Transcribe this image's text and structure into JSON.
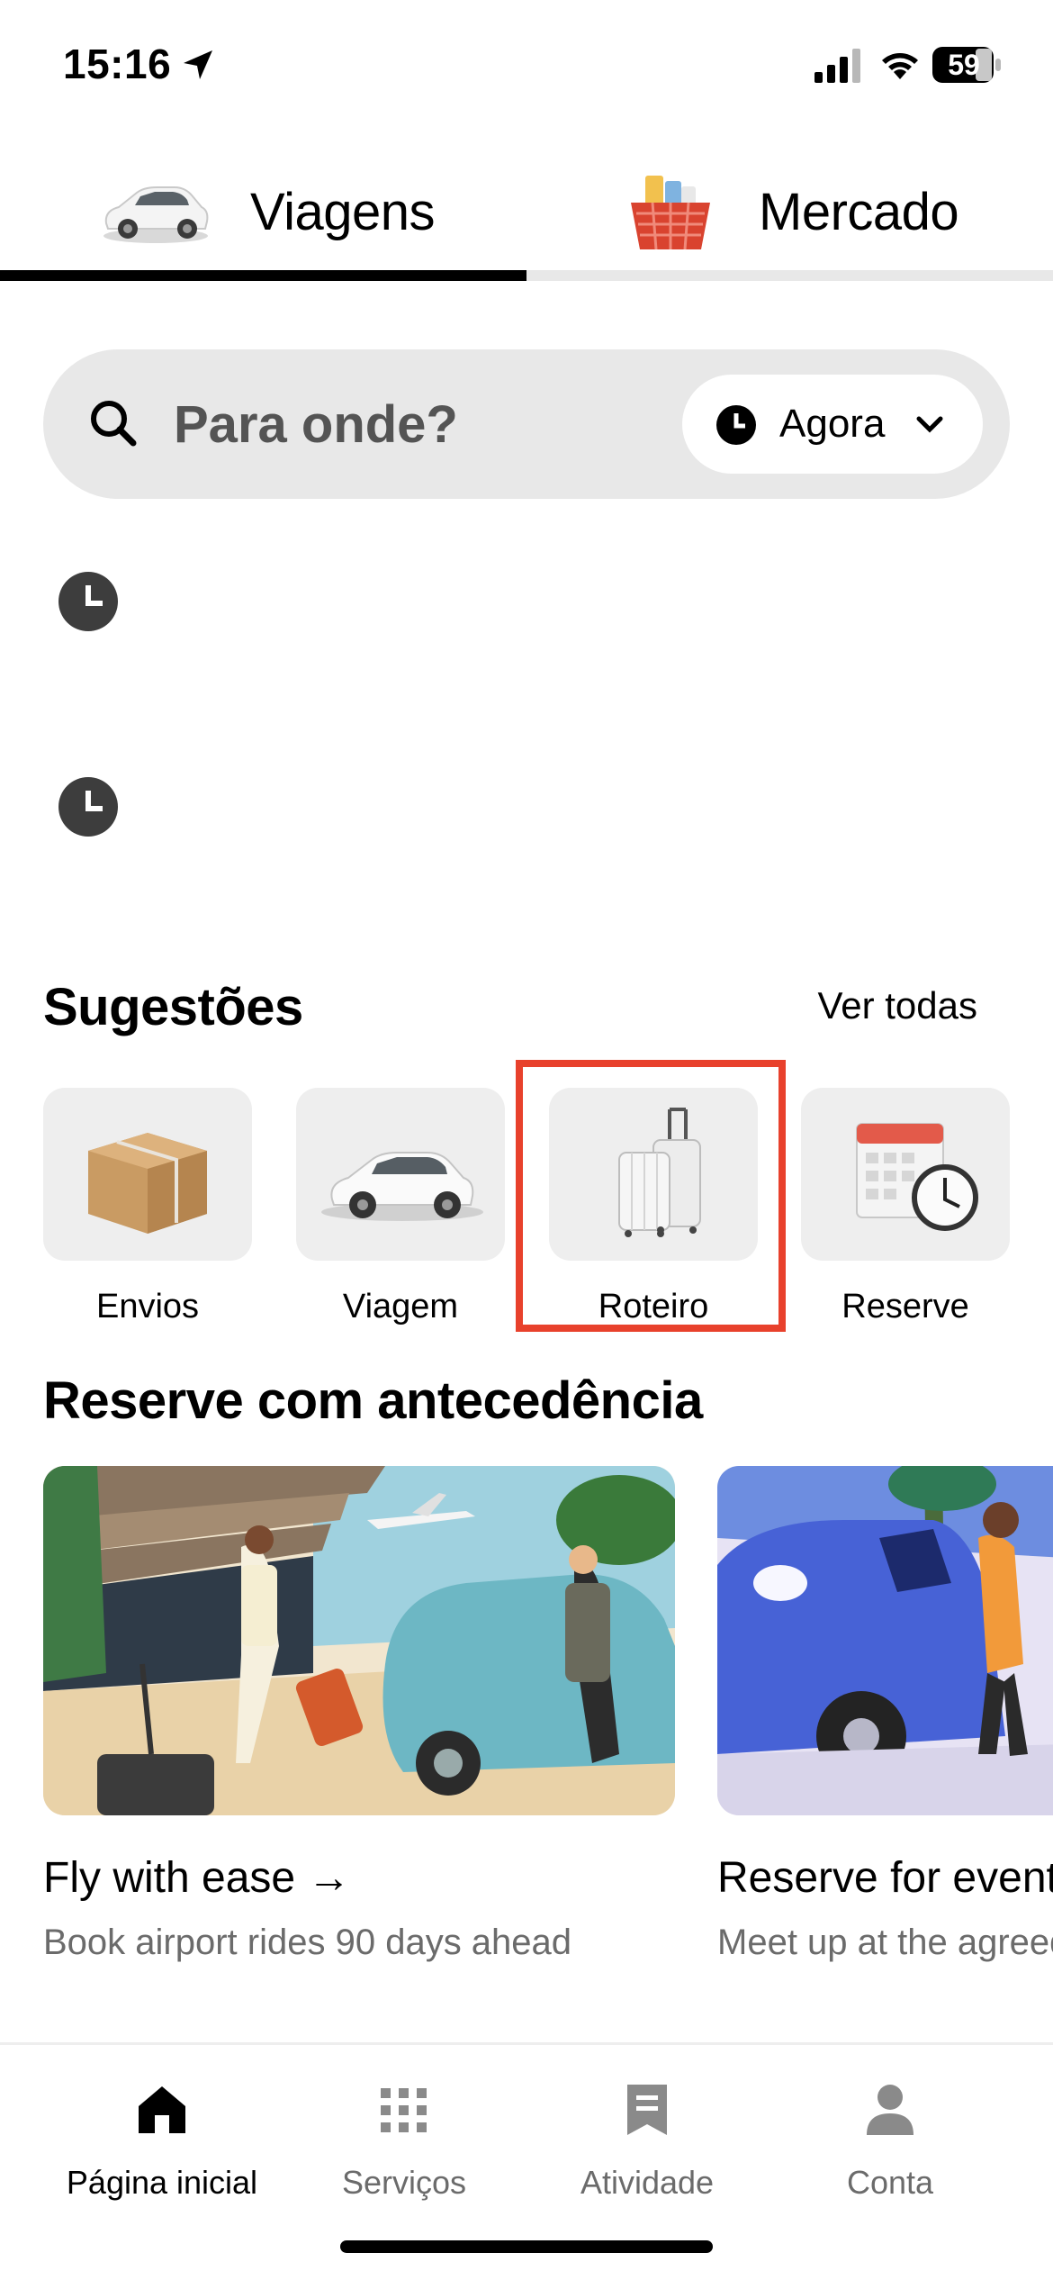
{
  "status_bar": {
    "time": "15:16",
    "battery": "59"
  },
  "top_tabs": [
    {
      "label": "Viagens",
      "icon": "car-icon",
      "active": true
    },
    {
      "label": "Mercado",
      "icon": "grocery-basket-icon",
      "active": false
    }
  ],
  "search": {
    "placeholder": "Para onde?",
    "time_option": "Agora"
  },
  "recent_items": [
    {
      "icon": "clock-icon"
    },
    {
      "icon": "clock-icon"
    }
  ],
  "suggestions": {
    "title": "Sugestões",
    "see_all": "Ver todas",
    "items": [
      {
        "label": "Envios",
        "icon": "package-icon"
      },
      {
        "label": "Viagem",
        "icon": "car-icon"
      },
      {
        "label": "Roteiro",
        "icon": "luggage-icon",
        "highlighted": true
      },
      {
        "label": "Reserve",
        "icon": "calendar-clock-icon"
      }
    ]
  },
  "reserve": {
    "title": "Reserve com antecedência",
    "cards": [
      {
        "title": "Fly with ease →",
        "subtitle": "Book airport rides 90 days ahead"
      },
      {
        "title": "Reserve for events",
        "subtitle": "Meet up at the agreed spot"
      }
    ]
  },
  "bottom_nav": [
    {
      "label": "Página inicial",
      "icon": "home-icon",
      "active": true
    },
    {
      "label": "Serviços",
      "icon": "grid-icon",
      "active": false
    },
    {
      "label": "Atividade",
      "icon": "receipt-icon",
      "active": false
    },
    {
      "label": "Conta",
      "icon": "person-icon",
      "active": false
    }
  ],
  "colors": {
    "highlight": "#e8412c",
    "search_bg": "#e8e8e8",
    "tile_bg": "#eeeeee",
    "muted": "#6b6b6b"
  }
}
